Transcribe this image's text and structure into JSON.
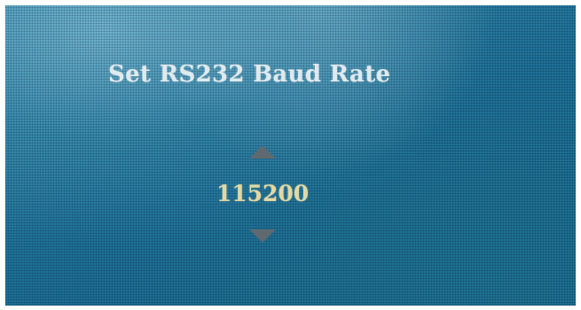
{
  "osd": {
    "title": "Set RS232 Baud Rate",
    "baud_rate_value": "115200"
  },
  "icons": {
    "increase": "triangle-up-icon",
    "decrease": "triangle-down-icon"
  },
  "colors": {
    "screen_background": "#1f7198",
    "title_text": "#dfe9ee",
    "value_text": "#e2d8a3",
    "arrow": "#5e6a70"
  }
}
